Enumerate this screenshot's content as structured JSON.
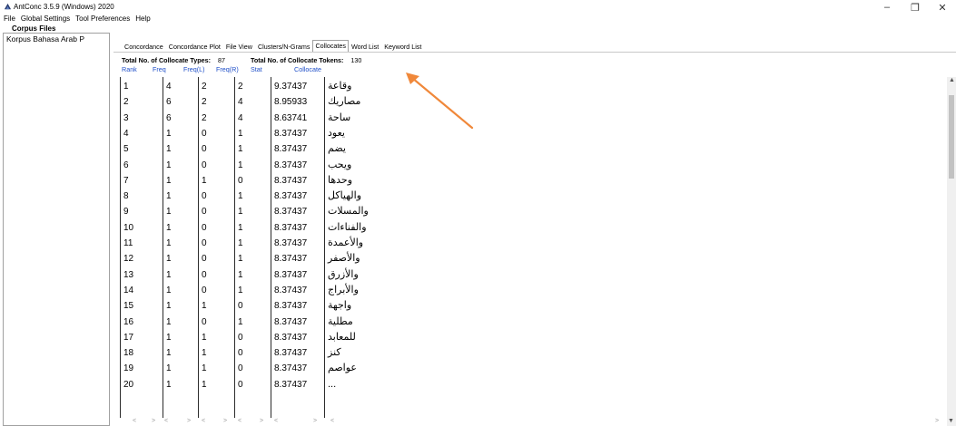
{
  "window": {
    "title": "AntConc 3.5.9 (Windows) 2020",
    "minimize_glyph": "–",
    "maximize_glyph": "❐",
    "close_glyph": "✕"
  },
  "menu": [
    "File",
    "Global Settings",
    "Tool Preferences",
    "Help"
  ],
  "corpus": {
    "title": "Corpus Files",
    "files": [
      "Korpus Bahasa Arab P"
    ]
  },
  "tabs": [
    "Concordance",
    "Concordance Plot",
    "File View",
    "Clusters/N-Grams",
    "Collocates",
    "Word List",
    "Keyword List"
  ],
  "active_tab": "Collocates",
  "totals": {
    "types_label": "Total No. of Collocate Types:",
    "types_value": "87",
    "tokens_label": "Total No. of Collocate Tokens:",
    "tokens_value": "130"
  },
  "columns": [
    "Rank",
    "Freq",
    "Freq(L)",
    "Freq(R)",
    "Stat",
    "Collocate"
  ],
  "rows": [
    [
      "1",
      "4",
      "2",
      "2",
      "9.37437",
      "وقاعة"
    ],
    [
      "2",
      "6",
      "2",
      "4",
      "8.95933",
      "مصاريك"
    ],
    [
      "3",
      "6",
      "2",
      "4",
      "8.63741",
      "ساحة"
    ],
    [
      "4",
      "1",
      "0",
      "1",
      "8.37437",
      "يعود"
    ],
    [
      "5",
      "1",
      "0",
      "1",
      "8.37437",
      "يضم"
    ],
    [
      "6",
      "1",
      "0",
      "1",
      "8.37437",
      "ويحب"
    ],
    [
      "7",
      "1",
      "1",
      "0",
      "8.37437",
      "وحدها"
    ],
    [
      "8",
      "1",
      "0",
      "1",
      "8.37437",
      "والهياكل"
    ],
    [
      "9",
      "1",
      "0",
      "1",
      "8.37437",
      "والمسلات"
    ],
    [
      "10",
      "1",
      "0",
      "1",
      "8.37437",
      "والفناءات"
    ],
    [
      "11",
      "1",
      "0",
      "1",
      "8.37437",
      "والأعمدة"
    ],
    [
      "12",
      "1",
      "0",
      "1",
      "8.37437",
      "والأصفر"
    ],
    [
      "13",
      "1",
      "0",
      "1",
      "8.37437",
      "والأزرق"
    ],
    [
      "14",
      "1",
      "0",
      "1",
      "8.37437",
      "والأبراج"
    ],
    [
      "15",
      "1",
      "1",
      "0",
      "8.37437",
      "واجهة"
    ],
    [
      "16",
      "1",
      "0",
      "1",
      "8.37437",
      "مطلية"
    ],
    [
      "17",
      "1",
      "1",
      "0",
      "8.37437",
      "للمعابد"
    ],
    [
      "18",
      "1",
      "1",
      "0",
      "8.37437",
      "كنز"
    ],
    [
      "19",
      "1",
      "1",
      "0",
      "8.37437",
      "عواصم"
    ],
    [
      "20",
      "1",
      "1",
      "0",
      "8.37437",
      "..."
    ]
  ],
  "colors": {
    "header_text": "#1f4fc8",
    "annotation_arrow": "#f0883a"
  }
}
